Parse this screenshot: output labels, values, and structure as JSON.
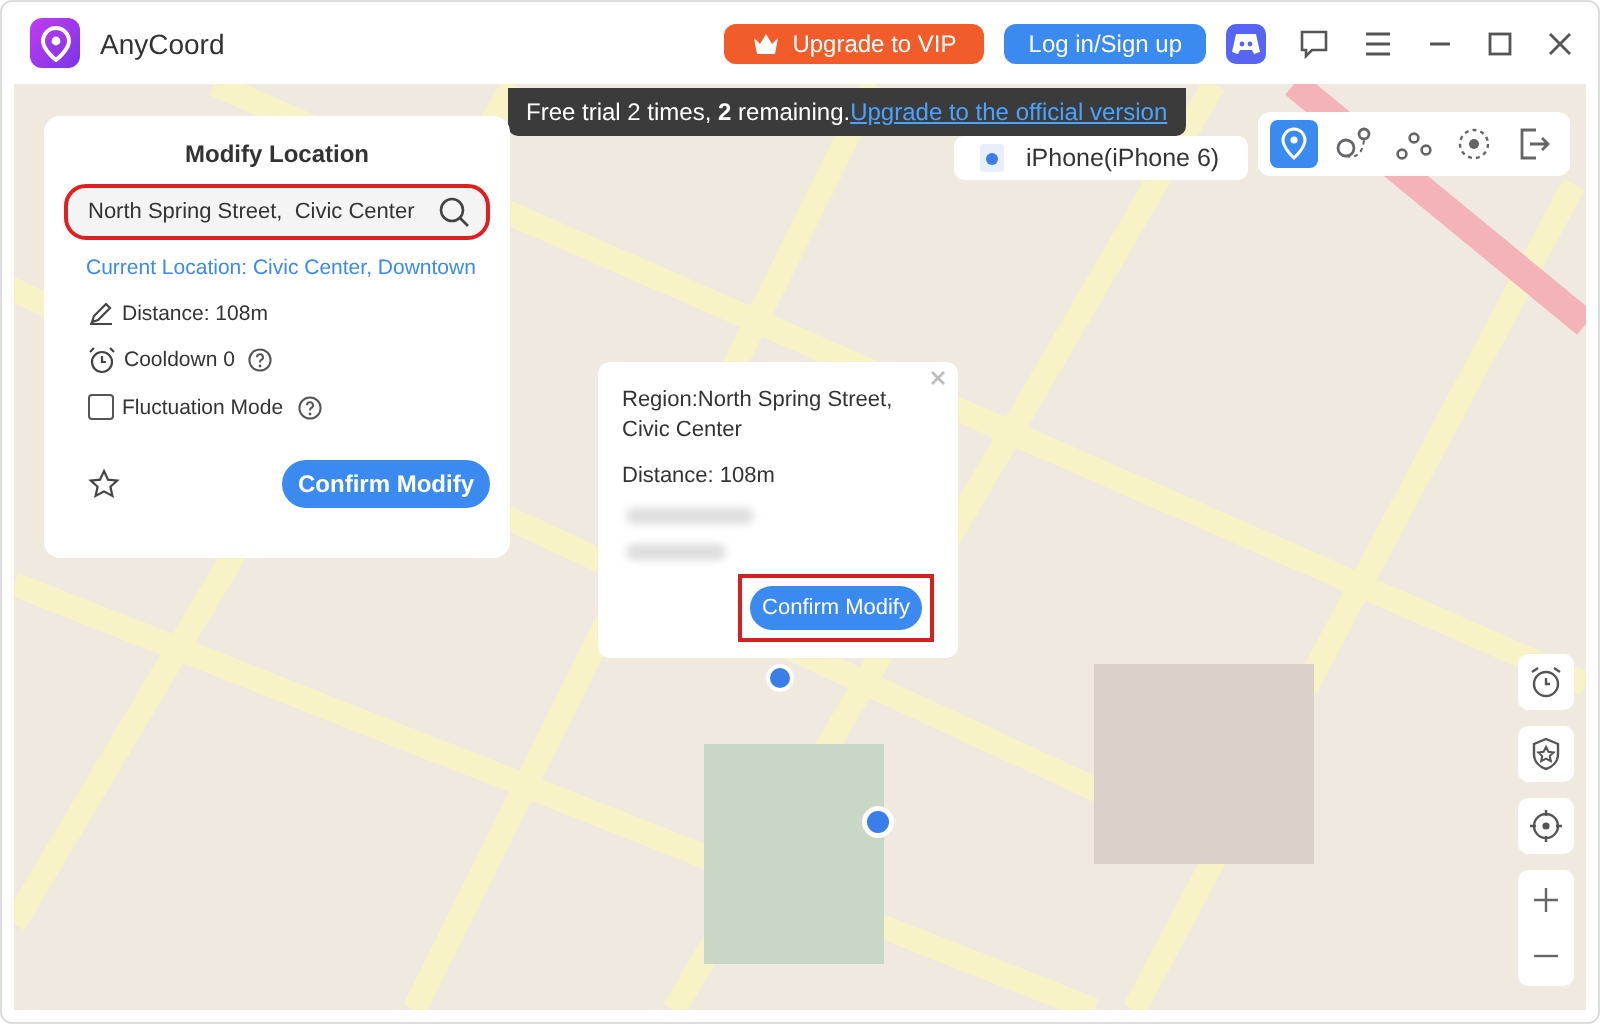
{
  "window": {
    "title": "AnyCoord"
  },
  "header": {
    "upgrade_button": "Upgrade to VIP",
    "login_button": "Log in/Sign up"
  },
  "trial_banner": {
    "text": "Free trial 2 times, **2** remaining.",
    "link": "Upgrade to the official version"
  },
  "device": {
    "name": "iPhone(iPhone 6)"
  },
  "modes": [
    {
      "kind": "teleport",
      "selected": true
    },
    {
      "kind": "one-stop",
      "selected": false
    },
    {
      "kind": "multi-stop",
      "selected": false
    },
    {
      "kind": "joystick",
      "selected": false
    },
    {
      "kind": "exit",
      "selected": false
    }
  ],
  "panel": {
    "title": "Modify Location",
    "search": {
      "value": "North Spring Street,  Civic Center"
    },
    "current_location": "Current Location: Civic Center, Downtown",
    "distance": "Distance: 108m",
    "cooldown": "Cooldown 0",
    "fluctuation": {
      "label": "Fluctuation Mode",
      "checked": false
    },
    "confirm_button": "Confirm Modify"
  },
  "popup": {
    "region": "Region:North Spring Street, Civic Center",
    "distance": "Distance: 108m",
    "confirm_button": "Confirm Modify"
  }
}
